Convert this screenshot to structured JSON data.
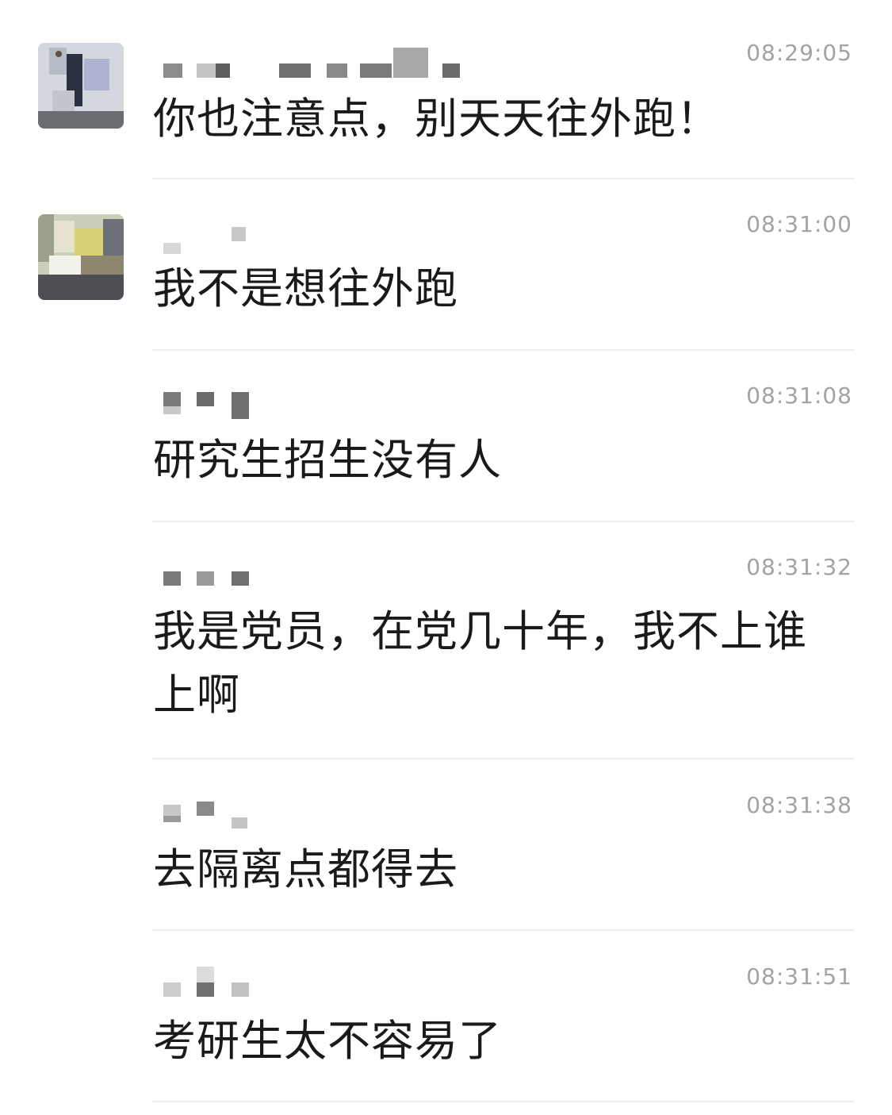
{
  "messages": [
    {
      "time": "08:29:05",
      "text": "你也注意点，别天天往外跑！"
    },
    {
      "time": "08:31:00",
      "text": "我不是想往外跑"
    },
    {
      "time": "08:31:08",
      "text": "研究生招生没有人"
    },
    {
      "time": "08:31:32",
      "text": "我是党员，在党几十年，我不上谁上啊"
    },
    {
      "time": "08:31:38",
      "text": "去隔离点都得去"
    },
    {
      "time": "08:31:51",
      "text": "考研生太不容易了"
    }
  ],
  "colors": {
    "timestamp": "#a3a3a3",
    "message_text": "#1a1a1a",
    "divider": "#ececec",
    "blur_block_dark": "#6b6b6b",
    "blur_block_light": "#c9c9c9"
  }
}
